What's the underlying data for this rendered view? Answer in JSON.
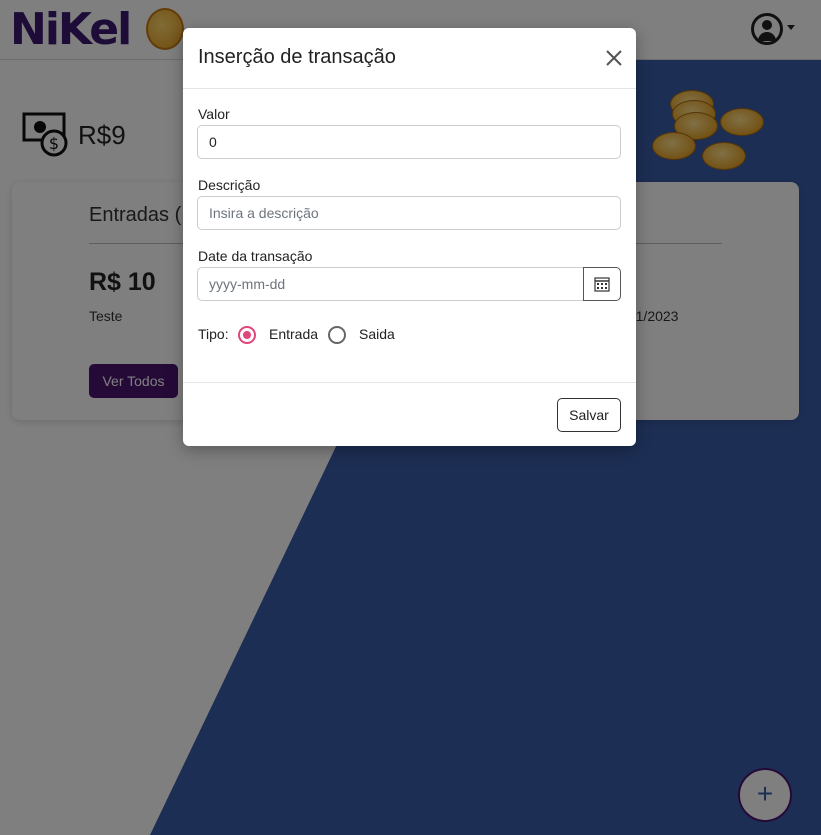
{
  "header": {
    "logo_text": "NiKel",
    "user_icon": "user-circle-icon",
    "dropdown_icon": "caret-down-icon"
  },
  "balance": {
    "icon": "money-bill-icon",
    "value": "R$9"
  },
  "card": {
    "title": "Entradas (",
    "amount": "R$ 10",
    "description": "Teste",
    "date_partial": "/11/2023",
    "button_label": "Ver Todos"
  },
  "fab": {
    "label": "+"
  },
  "modal": {
    "title": "Inserção de transação",
    "close_icon": "close-icon",
    "fields": {
      "valor_label": "Valor",
      "valor_value": "0",
      "descricao_label": "Descrição",
      "descricao_placeholder": "Insira a descrição",
      "data_label": "Date da transação",
      "data_placeholder": "yyyy-mm-dd",
      "calendar_icon": "calendar-icon"
    },
    "tipo": {
      "label": "Tipo:",
      "options": [
        "Entrada",
        "Saida"
      ],
      "selected": "Entrada"
    },
    "save_label": "Salvar"
  },
  "colors": {
    "brand_purple": "#4a1470",
    "blue": "#3b5da8",
    "radio_accent": "#e0457b"
  }
}
